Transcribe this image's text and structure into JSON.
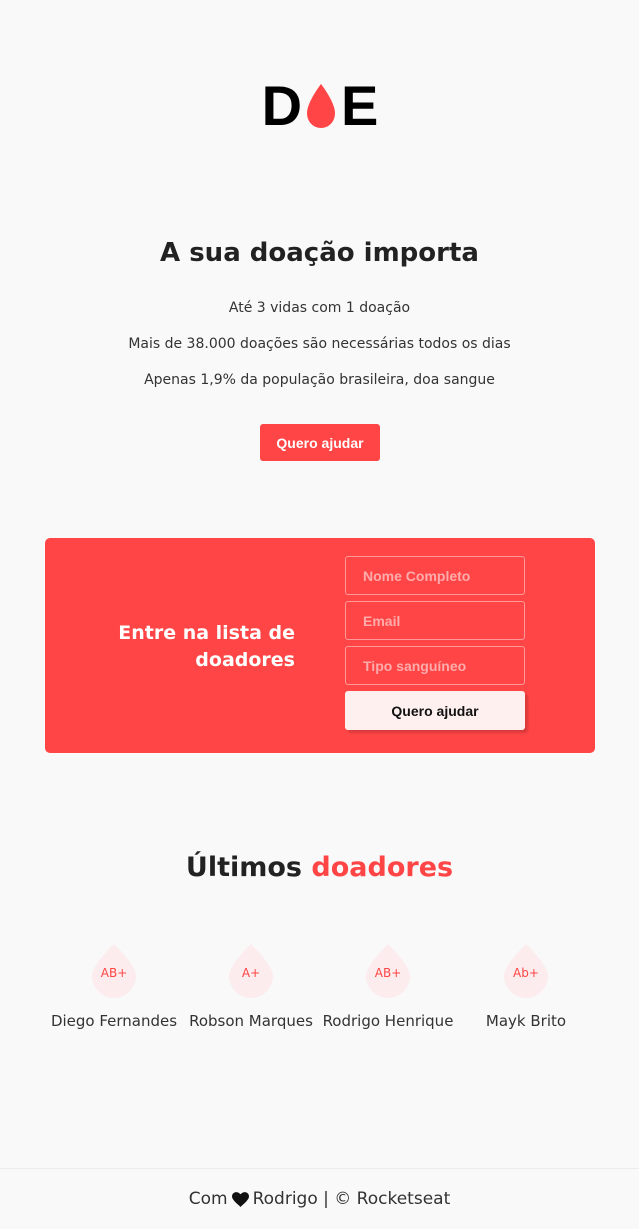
{
  "logo": {
    "letter_d": "D",
    "letter_e": "E",
    "drop_color": "#ff4545"
  },
  "hero": {
    "title": "A sua doação importa",
    "lines": [
      "Até 3 vidas com 1 doação",
      "Mais de 38.000 doações são necessárias todos os dias",
      "Apenas 1,9% da população brasileira, doa sangue"
    ],
    "cta_label": "Quero ajudar"
  },
  "signup": {
    "title_line1": "Entre na lista de",
    "title_line2": "doadores",
    "fields": {
      "name_placeholder": "Nome Completo",
      "email_placeholder": "Email",
      "blood_placeholder": "Tipo sanguíneo"
    },
    "submit_label": "Quero ajudar"
  },
  "donors": {
    "title_plain": "Últimos",
    "title_accent": "doadores",
    "list": [
      {
        "blood": "AB+",
        "name": "Diego Fernandes"
      },
      {
        "blood": "A+",
        "name": "Robson Marques"
      },
      {
        "blood": "AB+",
        "name": "Rodrigo Henrique"
      },
      {
        "blood": "Ab+",
        "name": "Mayk Brito"
      }
    ]
  },
  "footer": {
    "prefix": "Com",
    "heart_icon": "heart-icon",
    "suffix": "Rodrigo | © Rocketseat"
  },
  "colors": {
    "brand": "#ff4545",
    "drop_light": "#fceced",
    "background": "#f9f9f9"
  }
}
